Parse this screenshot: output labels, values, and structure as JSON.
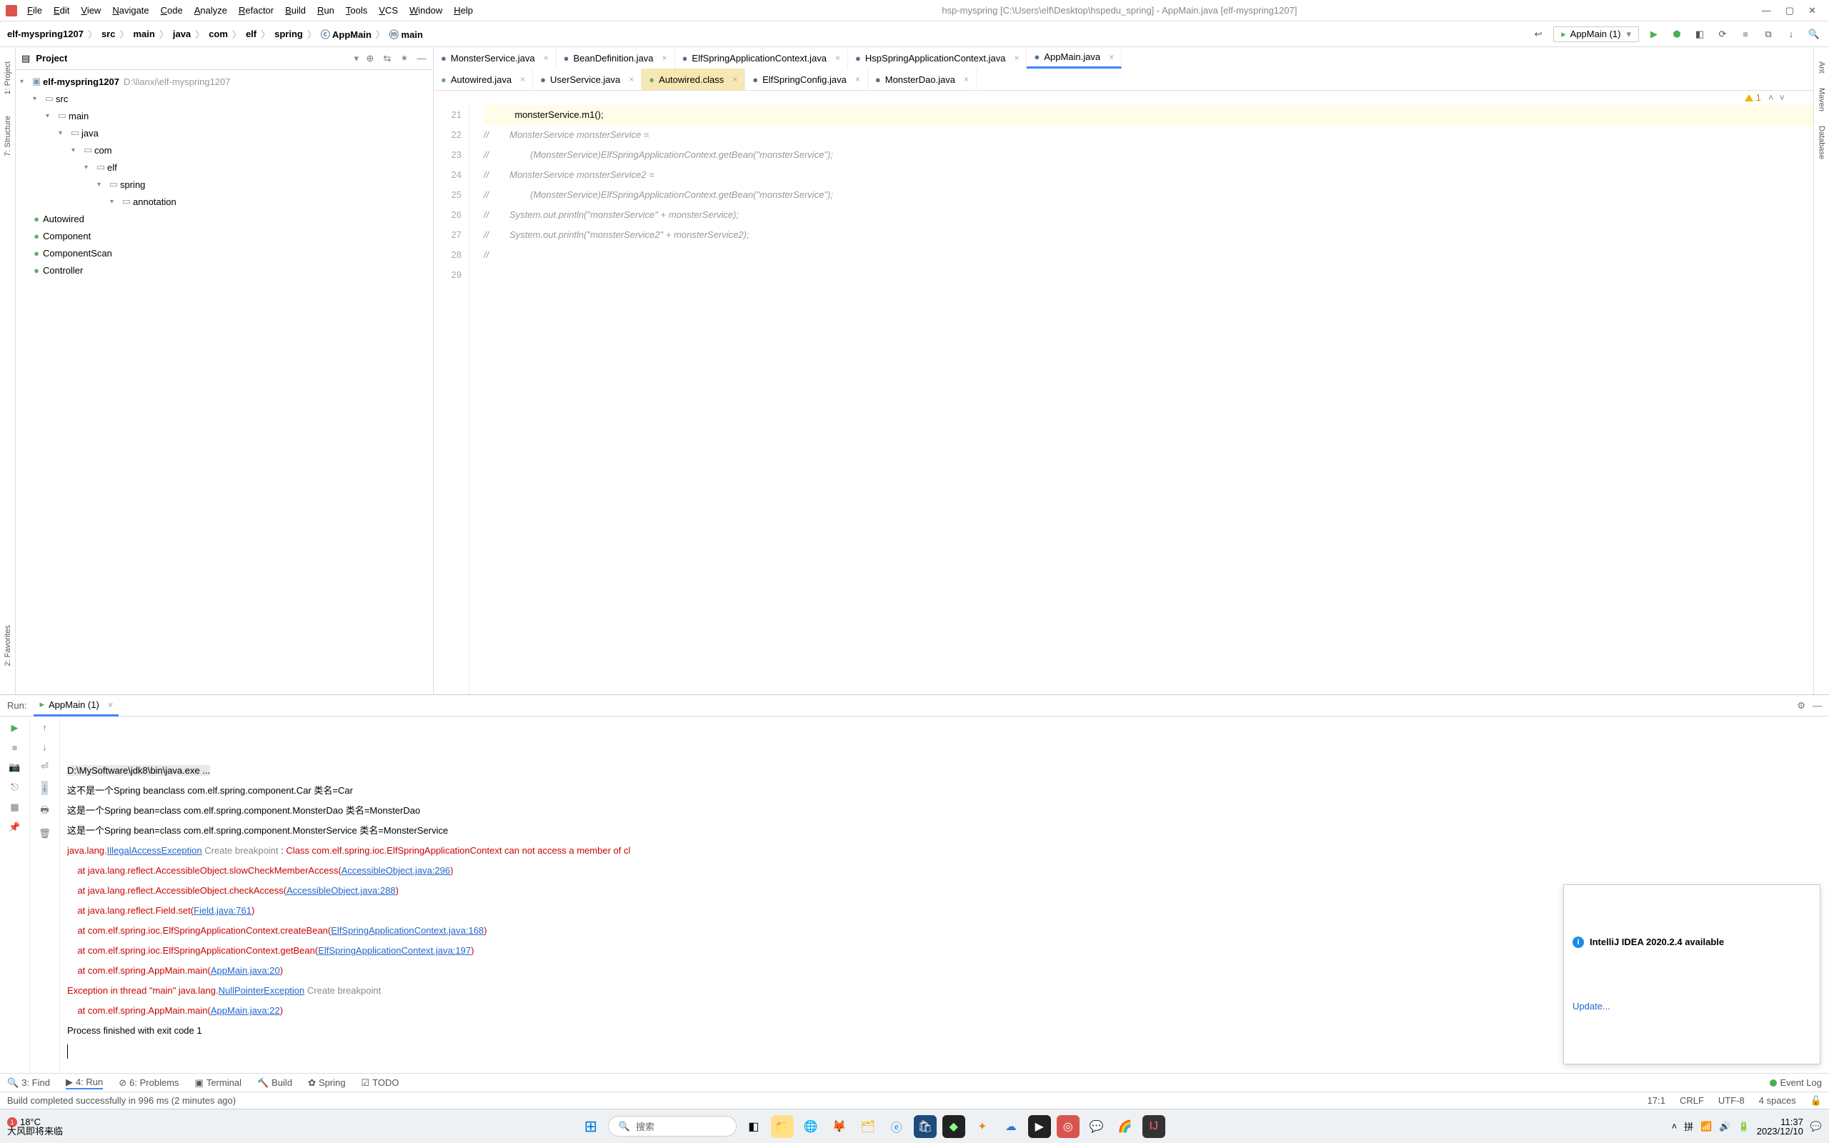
{
  "window": {
    "title": "hsp-myspring [C:\\Users\\elf\\Desktop\\hspedu_spring] - AppMain.java [elf-myspring1207]"
  },
  "menu": [
    "File",
    "Edit",
    "View",
    "Navigate",
    "Code",
    "Analyze",
    "Refactor",
    "Build",
    "Run",
    "Tools",
    "VCS",
    "Window",
    "Help"
  ],
  "breadcrumb": [
    "elf-myspring1207",
    "src",
    "main",
    "java",
    "com",
    "elf",
    "spring",
    "AppMain",
    "main"
  ],
  "run_config": "AppMain (1)",
  "project": {
    "title": "Project",
    "root": {
      "name": "elf-myspring1207",
      "path": "D:\\lianxi\\elf-myspring1207"
    },
    "nodes": [
      {
        "indent": 1,
        "type": "folder",
        "name": "src",
        "open": true
      },
      {
        "indent": 2,
        "type": "folder",
        "name": "main",
        "open": true
      },
      {
        "indent": 3,
        "type": "folder",
        "name": "java",
        "open": true
      },
      {
        "indent": 4,
        "type": "pkg",
        "name": "com",
        "open": true
      },
      {
        "indent": 5,
        "type": "pkg",
        "name": "elf",
        "open": true
      },
      {
        "indent": 6,
        "type": "pkg",
        "name": "spring",
        "open": true
      },
      {
        "indent": 7,
        "type": "pkg",
        "name": "annotation",
        "open": true
      },
      {
        "indent": 8,
        "type": "class",
        "name": "Autowired"
      },
      {
        "indent": 8,
        "type": "class",
        "name": "Component"
      },
      {
        "indent": 8,
        "type": "class",
        "name": "ComponentScan"
      },
      {
        "indent": 8,
        "type": "class",
        "name": "Controller"
      }
    ]
  },
  "editor_tabs_row1": [
    {
      "name": "MonsterService.java",
      "icon": "c"
    },
    {
      "name": "BeanDefinition.java",
      "icon": "c"
    },
    {
      "name": "ElfSpringApplicationContext.java",
      "icon": "c"
    },
    {
      "name": "HspSpringApplicationContext.java",
      "icon": "c"
    },
    {
      "name": "AppMain.java",
      "icon": "c",
      "active": true
    }
  ],
  "editor_tabs_row2": [
    {
      "name": "Autowired.java",
      "icon": "j"
    },
    {
      "name": "UserService.java",
      "icon": "c"
    },
    {
      "name": "Autowired.class",
      "icon": "j",
      "highlight": true
    },
    {
      "name": "ElfSpringConfig.java",
      "icon": "c"
    },
    {
      "name": "MonsterDao.java",
      "icon": "c"
    }
  ],
  "editor": {
    "warning_count": "1",
    "lines": [
      {
        "n": 21,
        "text": ""
      },
      {
        "n": 22,
        "text": "            monsterService.m1();",
        "hl": true
      },
      {
        "n": 23,
        "text": "//        MonsterService monsterService =",
        "cmt": true,
        "prefix": "//"
      },
      {
        "n": 24,
        "text": "//                (MonsterService)ElfSpringApplicationContext.getBean(\"monsterService\");",
        "cmt": true
      },
      {
        "n": 25,
        "text": "//        MonsterService monsterService2 =",
        "cmt": true
      },
      {
        "n": 26,
        "text": "//                (MonsterService)ElfSpringApplicationContext.getBean(\"monsterService\");",
        "cmt": true
      },
      {
        "n": 27,
        "text": "//        System.out.println(\"monsterService\" + monsterService);",
        "cmt": true
      },
      {
        "n": 28,
        "text": "//        System.out.println(\"monsterService2\" + monsterService2);",
        "cmt": true
      },
      {
        "n": 29,
        "text": "//",
        "cmt": true
      }
    ]
  },
  "run": {
    "label": "Run:",
    "tab": "AppMain (1)",
    "lines": [
      {
        "segs": [
          {
            "t": "D:\\MySoftware\\jdk8\\bin\\java.exe ...",
            "cls": "hlbg"
          }
        ]
      },
      {
        "segs": [
          {
            "t": "这不是一个Spring beanclass com.elf.spring.component.Car 类名=Car"
          }
        ]
      },
      {
        "segs": [
          {
            "t": "这是一个Spring bean=class com.elf.spring.component.MonsterDao 类名=MonsterDao"
          }
        ]
      },
      {
        "segs": [
          {
            "t": "这是一个Spring bean=class com.elf.spring.component.MonsterService 类名=MonsterService"
          }
        ]
      },
      {
        "segs": [
          {
            "t": "java.lang.",
            "cls": "err"
          },
          {
            "t": "IllegalAccessException",
            "cls": "err link"
          },
          {
            "t": " Create breakpoint",
            "cls": "gray"
          },
          {
            "t": " : Class com.elf.spring.ioc.ElfSpringApplicationContext can not access a member of cl",
            "cls": "err"
          }
        ]
      },
      {
        "segs": [
          {
            "t": "    at java.lang.reflect.AccessibleObject.slowCheckMemberAccess(",
            "cls": "err"
          },
          {
            "t": "AccessibleObject.java:296",
            "cls": "link"
          },
          {
            "t": ")",
            "cls": "err"
          }
        ]
      },
      {
        "segs": [
          {
            "t": "    at java.lang.reflect.AccessibleObject.checkAccess(",
            "cls": "err"
          },
          {
            "t": "AccessibleObject.java:288",
            "cls": "link"
          },
          {
            "t": ")",
            "cls": "err"
          }
        ]
      },
      {
        "segs": [
          {
            "t": "    at java.lang.reflect.Field.set(",
            "cls": "err"
          },
          {
            "t": "Field.java:761",
            "cls": "link"
          },
          {
            "t": ")",
            "cls": "err"
          }
        ]
      },
      {
        "segs": [
          {
            "t": "    at com.elf.spring.ioc.ElfSpringApplicationContext.createBean(",
            "cls": "err"
          },
          {
            "t": "ElfSpringApplicationContext.java:168",
            "cls": "link"
          },
          {
            "t": ")",
            "cls": "err"
          }
        ]
      },
      {
        "segs": [
          {
            "t": "    at com.elf.spring.ioc.ElfSpringApplicationContext.getBean(",
            "cls": "err"
          },
          {
            "t": "ElfSpringApplicationContext.java:197",
            "cls": "link"
          },
          {
            "t": ")",
            "cls": "err"
          }
        ]
      },
      {
        "segs": [
          {
            "t": "    at com.elf.spring.AppMain.main(",
            "cls": "err"
          },
          {
            "t": "AppMain.java:20",
            "cls": "link"
          },
          {
            "t": ")",
            "cls": "err"
          }
        ]
      },
      {
        "segs": [
          {
            "t": "Exception in thread \"main\" java.lang.",
            "cls": "err"
          },
          {
            "t": "NullPointerException",
            "cls": "err link"
          },
          {
            "t": " Create breakpoint",
            "cls": "gray"
          }
        ]
      },
      {
        "segs": [
          {
            "t": "    at com.elf.spring.AppMain.main(",
            "cls": "err"
          },
          {
            "t": "AppMain.java:22",
            "cls": "link"
          },
          {
            "t": ")",
            "cls": "err"
          }
        ]
      },
      {
        "segs": [
          {
            "t": ""
          }
        ]
      },
      {
        "segs": [
          {
            "t": "Process finished with exit code 1"
          }
        ]
      }
    ]
  },
  "notification": {
    "title": "IntelliJ IDEA 2020.2.4 available",
    "action": "Update..."
  },
  "bottom_tabs": {
    "find": "3: Find",
    "run": "4: Run",
    "problems": "6: Problems",
    "terminal": "Terminal",
    "build": "Build",
    "spring": "Spring",
    "todo": "TODO",
    "event": "Event Log"
  },
  "status": {
    "msg": "Build completed successfully in 996 ms (2 minutes ago)",
    "pos": "17:1",
    "sep": "CRLF",
    "enc": "UTF-8",
    "indent": "4 spaces"
  },
  "left_tool": {
    "project": "1: Project",
    "structure": "7: Structure",
    "fav": "2: Favorites"
  },
  "right_tool": {
    "ant": "Ant",
    "maven": "Maven",
    "db": "Database"
  },
  "taskbar": {
    "temp": "18°C",
    "weather": "大风即将来临",
    "search": "搜索",
    "time": "11:37",
    "date": "2023/12/10"
  }
}
